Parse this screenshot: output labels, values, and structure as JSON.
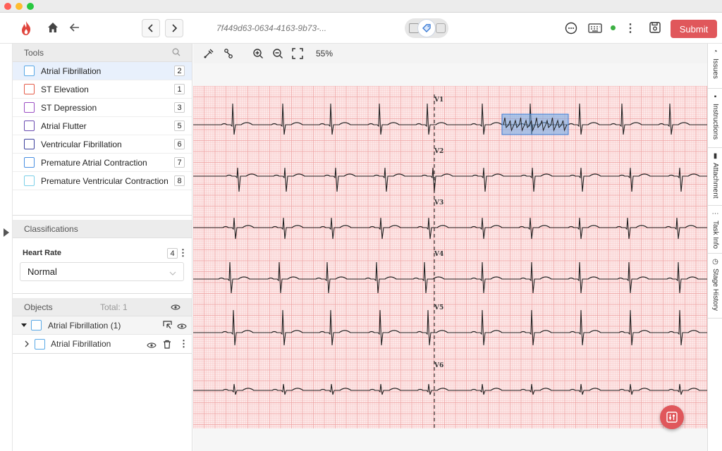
{
  "header": {
    "task_id": "7f449d63-0634-4163-9b73-...",
    "submit_label": "Submit",
    "status_color": "#3cb043",
    "accent": "#e0575b"
  },
  "tools": {
    "title": "Tools",
    "items": [
      {
        "label": "Atrial Fibrillation",
        "key": "2",
        "color": "#5aa9e6"
      },
      {
        "label": "ST Elevation",
        "key": "1",
        "color": "#e55d4a"
      },
      {
        "label": "ST Depression",
        "key": "3",
        "color": "#9b4fc4"
      },
      {
        "label": "Atrial Flutter",
        "key": "5",
        "color": "#6a4bb0"
      },
      {
        "label": "Ventricular Fibrillation",
        "key": "6",
        "color": "#3b3f9c"
      },
      {
        "label": "Premature Atrial Contraction",
        "key": "7",
        "color": "#4a90e2"
      },
      {
        "label": "Premature Ventricular Contraction",
        "key": "8",
        "color": "#7cd0e8"
      }
    ]
  },
  "classifications": {
    "title": "Classifications",
    "field_label": "Heart Rate",
    "field_key": "4",
    "selected": "Normal"
  },
  "objects": {
    "title": "Objects",
    "total": "Total: 1",
    "group_label": "Atrial Fibrillation (1)",
    "item_label": "Atrial Fibrillation"
  },
  "toolbar": {
    "zoom": "55%"
  },
  "ecg": {
    "leads": [
      "V1",
      "V2",
      "V3",
      "V4",
      "V5",
      "V6"
    ]
  },
  "right_tabs": [
    "Issues",
    "Instructions",
    "Attachment",
    "Task Info",
    "Stage History"
  ]
}
